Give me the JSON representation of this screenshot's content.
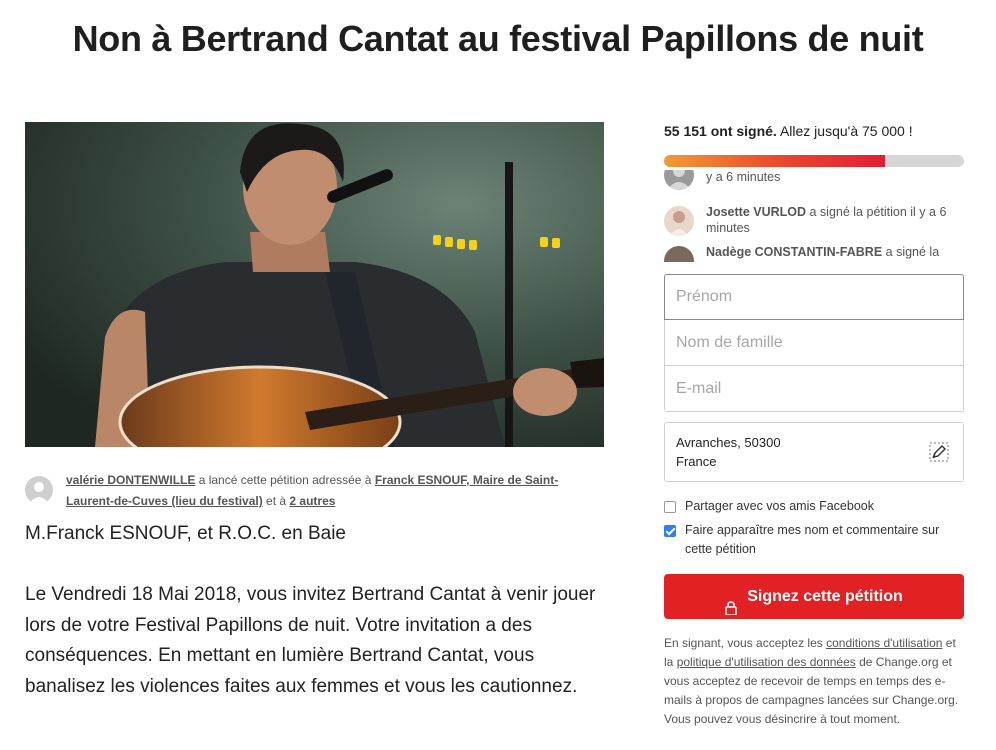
{
  "page_title": "Non à Bertrand Cantat au festival Papillons de nuit",
  "starter": {
    "name": "valérie DONTENWILLE",
    "text1": " a lancé cette pétition adressée à ",
    "target": "Franck ESNOUF, Maire de Saint-Laurent-de-Cuves (lieu du festival)",
    "text2": " et à ",
    "others": "2 autres"
  },
  "salutation": "M.Franck ESNOUF, et R.O.C. en Baie",
  "body": "Le Vendredi 18 Mai 2018, vous invitez Bertrand Cantat à venir jouer lors de votre Festival Papillons de nuit. Votre invitation a des conséquences. En mettant en lumière Bertrand Cantat, vous banalisez les violences faites aux femmes et vous les cautionnez.",
  "signatures": {
    "count_label": "55 151 ont signé.",
    "goal_label": " Allez jusqu'à 75 000 !",
    "signed": 55151,
    "goal": 75000,
    "progress_fraction": 0.7353
  },
  "feed": [
    {
      "name": "",
      "text": "y a 6 minutes"
    },
    {
      "name": "Josette VURLOD",
      "text": " a signé la pétition il y a 6 minutes"
    },
    {
      "name": "Nadège CONSTANTIN-FABRE",
      "text": " a signé la"
    }
  ],
  "form": {
    "first_name_placeholder": "Prénom",
    "last_name_placeholder": "Nom de famille",
    "email_placeholder": "E-mail",
    "location_line1": "Avranches, 50300",
    "location_line2": "France",
    "share_facebook_label": "Partager avec vos amis Facebook",
    "show_name_label": "Faire apparaître mes nom et commentaire sur cette pétition",
    "share_facebook_checked": false,
    "show_name_checked": true,
    "submit_label": "Signez cette pétition"
  },
  "legal": {
    "t1": "En signant, vous acceptez les ",
    "terms_link": "conditions d'utilisation",
    "t2": " et la ",
    "privacy_link": "politique d'utilisation des données",
    "t3": " de Change.org et vous acceptez de recevoir de temps en temps des e-mails à propos de campagnes lancées sur Change.org. Vous pouvez vous désincrire à tout moment."
  },
  "colors": {
    "sign_button": "#e22124",
    "progress_start": "#f29b35",
    "progress_end": "#e11d35",
    "checkbox_checked": "#2d7ff9"
  },
  "icons": {
    "lock": "lock-icon",
    "edit_location": "pencil-icon"
  }
}
